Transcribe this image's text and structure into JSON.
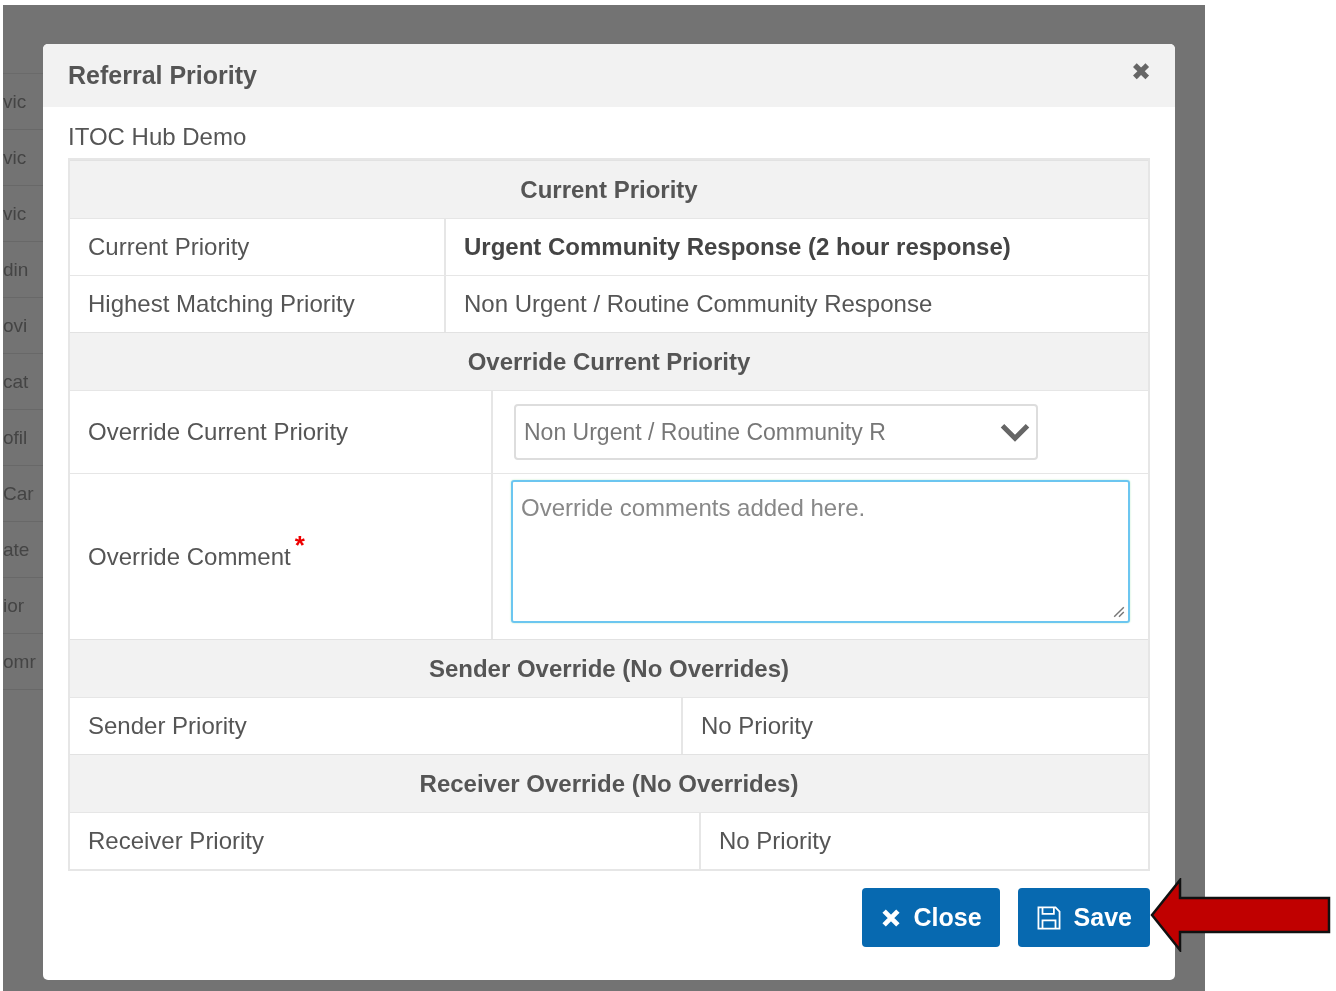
{
  "background": {
    "row_fragments": [
      "vic",
      "vic",
      "vic",
      "din",
      "ovi",
      "cat",
      "ofil",
      "Car",
      "ate",
      "ior",
      "omr"
    ]
  },
  "modal": {
    "title": "Referral Priority",
    "close_icon": "✖",
    "subtitle": "ITOC Hub Demo",
    "sections": [
      {
        "heading": "Current Priority",
        "rows": [
          {
            "kind": "text",
            "label": "Current Priority",
            "value": "Urgent Community Response (2 hour response)",
            "strong": true
          },
          {
            "kind": "text",
            "label": "Highest Matching Priority",
            "value": "Non Urgent / Routine Community Response",
            "strong": false
          }
        ]
      },
      {
        "heading": "Override Current Priority",
        "rows": [
          {
            "kind": "select",
            "label": "Override Current Priority",
            "value": "Non Urgent / Routine Community R"
          },
          {
            "kind": "textarea",
            "label": "Override Comment",
            "value": "Override comments added here.",
            "required_mark": "*"
          }
        ]
      },
      {
        "heading": "Sender Override (No Overrides)",
        "rows": [
          {
            "kind": "text",
            "label": "Sender Priority",
            "value": "No Priority",
            "strong": false
          }
        ]
      },
      {
        "heading": "Receiver Override (No Overrides)",
        "rows": [
          {
            "kind": "text",
            "label": "Receiver Priority",
            "value": "No Priority",
            "strong": false
          }
        ]
      }
    ],
    "buttons": [
      {
        "kind": "close",
        "label": "Close"
      },
      {
        "kind": "save",
        "label": "Save"
      }
    ]
  }
}
